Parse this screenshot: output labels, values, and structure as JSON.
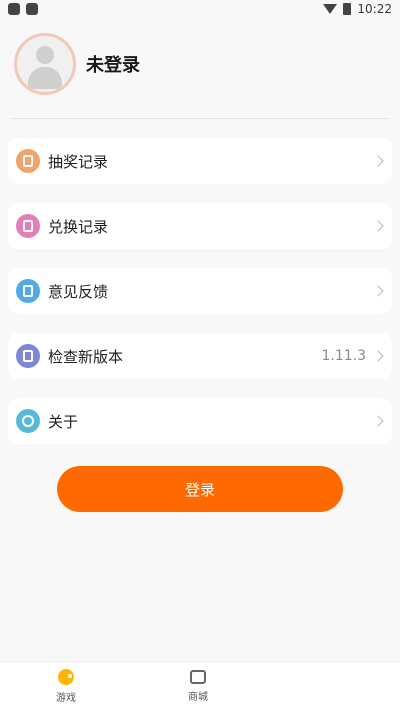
{
  "status_bar": {
    "time": "10:22"
  },
  "profile": {
    "name": "未登录"
  },
  "menu": [
    {
      "label": "抽奖记录",
      "value": "",
      "icon": "lottery-record-icon",
      "color": "#f0a36a"
    },
    {
      "label": "兑换记录",
      "value": "",
      "icon": "exchange-record-icon",
      "color": "#e57dbb"
    },
    {
      "label": "意见反馈",
      "value": "",
      "icon": "feedback-icon",
      "color": "#54a9e8"
    },
    {
      "label": "检查新版本",
      "value": "1.11.3",
      "icon": "check-update-icon",
      "color": "#7d87d8"
    },
    {
      "label": "关于",
      "value": "",
      "icon": "about-icon",
      "color": "#58b8d7"
    }
  ],
  "login_button": {
    "label": "登录",
    "color": "#ff6a00"
  },
  "bottom_nav": [
    {
      "label": "游戏",
      "icon": "game-icon"
    },
    {
      "label": "商城",
      "icon": "shop-icon"
    }
  ]
}
